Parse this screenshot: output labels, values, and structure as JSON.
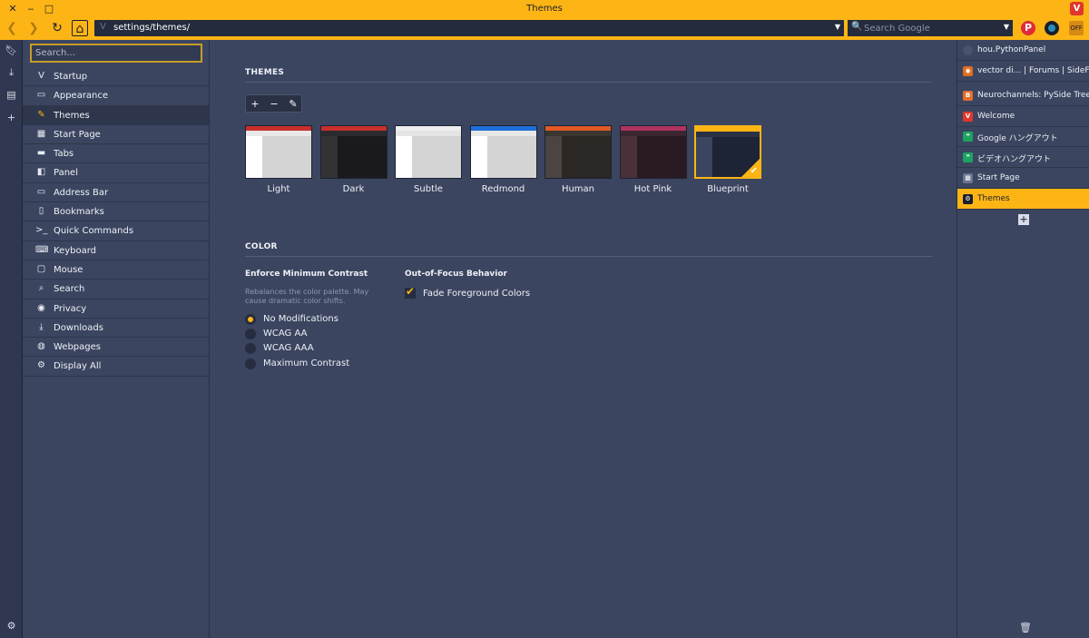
{
  "window": {
    "title": "Themes",
    "close_glyph": "✕",
    "minimize_glyph": "‒",
    "maximize_glyph": "□",
    "logo_letter": "V"
  },
  "toolbar": {
    "url": "settings/themes/",
    "search_placeholder": "Search Google",
    "colors": {
      "accent": "#fdb515",
      "dark": "#242b3c"
    },
    "ext_off_label": "OFF"
  },
  "left_strip": {
    "icons": [
      "bookmark-icon",
      "download-icon",
      "notes-icon",
      "plus-icon",
      "gear-icon"
    ]
  },
  "settings_nav": {
    "search_placeholder": "Search...",
    "items": [
      {
        "label": "Startup",
        "icon": "vivaldi-logo-icon"
      },
      {
        "label": "Appearance",
        "icon": "folder-icon"
      },
      {
        "label": "Themes",
        "icon": "brush-icon",
        "active": true
      },
      {
        "label": "Start Page",
        "icon": "grid-icon"
      },
      {
        "label": "Tabs",
        "icon": "tabs-icon"
      },
      {
        "label": "Panel",
        "icon": "panel-icon"
      },
      {
        "label": "Address Bar",
        "icon": "address-bar-icon"
      },
      {
        "label": "Bookmarks",
        "icon": "bookmark-icon"
      },
      {
        "label": "Quick Commands",
        "icon": "quick-commands-icon"
      },
      {
        "label": "Keyboard",
        "icon": "keyboard-icon"
      },
      {
        "label": "Mouse",
        "icon": "mouse-icon"
      },
      {
        "label": "Search",
        "icon": "search-icon"
      },
      {
        "label": "Privacy",
        "icon": "eye-icon"
      },
      {
        "label": "Downloads",
        "icon": "download-icon"
      },
      {
        "label": "Webpages",
        "icon": "globe-icon"
      },
      {
        "label": "Display All",
        "icon": "gear-icon"
      }
    ]
  },
  "themes_section": {
    "title": "THEMES",
    "tools": [
      "+",
      "−",
      "✎"
    ],
    "themes": [
      {
        "name": "Light",
        "top": "#c9302c",
        "bar": "#e8e8e8",
        "side": "#ffffff",
        "content": "#d4d4d4"
      },
      {
        "name": "Dark",
        "top": "#c9302c",
        "bar": "#2b2b2e",
        "side": "#333336",
        "content": "#1a1a1e"
      },
      {
        "name": "Subtle",
        "top": "#eeeeee",
        "bar": "#e4e4e4",
        "side": "#ffffff",
        "content": "#d4d4d4"
      },
      {
        "name": "Redmond",
        "top": "#1e6fd9",
        "bar": "#e8e8e8",
        "side": "#ffffff",
        "content": "#d4d4d4"
      },
      {
        "name": "Human",
        "top": "#e15a23",
        "bar": "#3a3632",
        "side": "#4a4540",
        "content": "#2a2724"
      },
      {
        "name": "Hot Pink",
        "top": "#b0335e",
        "bar": "#3a2730",
        "side": "#4a3038",
        "content": "#2a1b22"
      },
      {
        "name": "Blueprint",
        "top": "#fdb515",
        "bar": "#2a3145",
        "side": "#3b4560",
        "content": "#1d2436",
        "selected": true
      }
    ]
  },
  "color_section": {
    "title": "COLOR",
    "contrast": {
      "heading": "Enforce Minimum Contrast",
      "description": "Rebalances the color palette. May cause dramatic color shifts.",
      "options": [
        {
          "label": "No Modifications",
          "selected": true
        },
        {
          "label": "WCAG AA",
          "selected": false
        },
        {
          "label": "WCAG AAA",
          "selected": false
        },
        {
          "label": "Maximum Contrast",
          "selected": false
        }
      ]
    },
    "focus": {
      "heading": "Out-of-Focus Behavior",
      "checkbox_label": "Fade Foreground Colors",
      "checked": true
    }
  },
  "right_panel": {
    "items": [
      {
        "label": "hou.PythonPanel",
        "icon": "circle-icon",
        "color": "#4a536b"
      },
      {
        "label": "vector di... | Forums | SideFX",
        "icon": "rss-icon",
        "color": "#e06c1e"
      },
      {
        "label": "Neurochannels: PySide Tree Tutori",
        "icon": "blogger-icon",
        "color": "#e46f2a"
      },
      {
        "label": "Welcome",
        "icon": "vivaldi-icon",
        "color": "#e0362b"
      },
      {
        "label": "Google ハングアウト",
        "icon": "hangouts-icon",
        "color": "#1ea362"
      },
      {
        "label": "ビデオハングアウト",
        "icon": "hangouts-icon",
        "color": "#1ea362"
      },
      {
        "label": "Start Page",
        "icon": "grid-icon",
        "color": "#6b7590"
      },
      {
        "label": "Themes",
        "icon": "gear-icon",
        "color": "#1b1f2b",
        "active": true
      }
    ]
  }
}
